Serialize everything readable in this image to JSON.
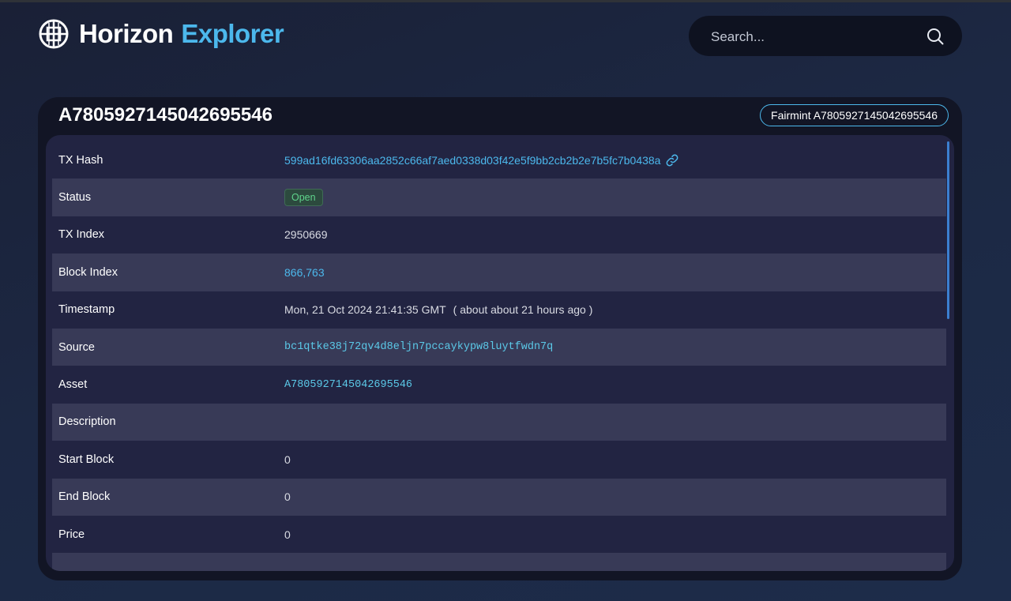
{
  "header": {
    "brand_word1": "Horizon",
    "brand_word2": "Explorer",
    "search_placeholder": "Search..."
  },
  "colors": {
    "accent": "#4cb8ec",
    "status_open": "#5fd48c",
    "background": "#1c2843"
  },
  "icons": {
    "logo": "horizon-logo-icon",
    "search": "search-icon",
    "copy": "link-icon"
  },
  "card": {
    "title": "A7805927145042695546",
    "action_label": "Fairmint A7805927145042695546"
  },
  "details": {
    "tx_hash_label": "TX Hash",
    "tx_hash_value": "599ad16fd63306aa2852c66af7aed0338d03f42e5f9bb2cb2b2e7b5fc7b0438a",
    "status_label": "Status",
    "status_value": "Open",
    "tx_index_label": "TX Index",
    "tx_index_value": "2950669",
    "block_index_label": "Block Index",
    "block_index_value": "866,763",
    "timestamp_label": "Timestamp",
    "timestamp_value": "Mon, 21 Oct 2024 21:41:35 GMT",
    "timestamp_relative": "( about about 21 hours ago )",
    "source_label": "Source",
    "source_value": "bc1qtke38j72qv4d8eljn7pccaykypw8luytfwdn7q",
    "asset_label": "Asset",
    "asset_value": "A7805927145042695546",
    "description_label": "Description",
    "description_value": "",
    "start_block_label": "Start Block",
    "start_block_value": "0",
    "end_block_label": "End Block",
    "end_block_value": "0",
    "price_label": "Price",
    "price_value": "0"
  }
}
